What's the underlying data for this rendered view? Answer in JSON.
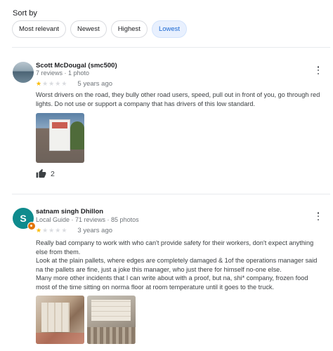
{
  "sort": {
    "label": "Sort by",
    "options": [
      "Most relevant",
      "Newest",
      "Highest",
      "Lowest"
    ],
    "selected": "Lowest"
  },
  "reviews": [
    {
      "name": "Scott McDougal (smc500)",
      "meta": "7 reviews · 1 photo",
      "rating": 1,
      "time": "5 years ago",
      "text": [
        "Worst drivers on the road, they bully other road users, speed, pull out in front of you, go through red lights. Do not use or support a company that has drivers of this low standard."
      ],
      "likes": "2",
      "avatar": "photo"
    },
    {
      "name": "satnam singh Dhillon",
      "meta": "Local Guide · 71 reviews · 85 photos",
      "avatar_letter": "S",
      "rating": 1,
      "time": "3 years ago",
      "text": [
        "Really bad company to work with who can't provide safety for their workers, don't expect anything else from them.",
        "Look at the plain pallets, where edges are completely damaged & 1of the operations manager said na the pallets  are fine, just a joke this manager, who just there for himself no-one else.",
        "Many more other incidents that I can write about with a proof, but na, shi* company, frozen food most of the time sitting on norma floor at room temperature until it goes to the truck."
      ]
    }
  ],
  "colors": {
    "star_filled": "#fbbc04",
    "star_empty": "#dadce0",
    "chip_selected_bg": "#e8f0fe",
    "chip_selected_text": "#1967d2",
    "avatar_letter_bg": "#0f8b8d",
    "local_guide_badge": "#e37400"
  }
}
